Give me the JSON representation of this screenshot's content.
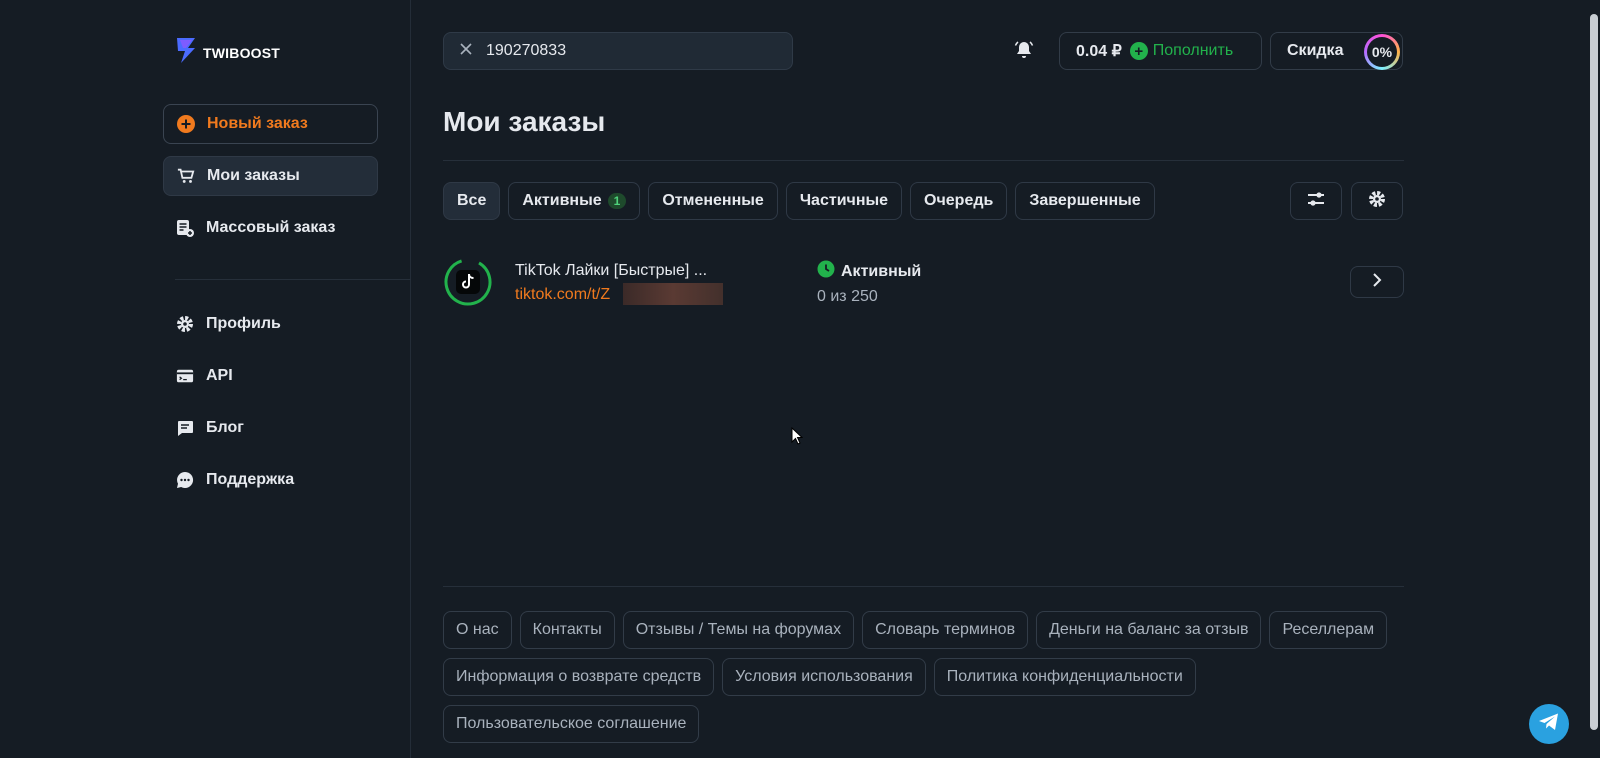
{
  "brand": {
    "name": "TWIBOOST"
  },
  "sidebar": {
    "new_order": "Новый заказ",
    "my_orders": "Мои заказы",
    "mass_order": "Массовый заказ",
    "profile": "Профиль",
    "api": "API",
    "blog": "Блог",
    "support": "Поддержка"
  },
  "header": {
    "search_value": "190270833",
    "balance": "0.04 ₽",
    "topup_label": "Пополнить",
    "discount_label": "Скидка",
    "discount_value": "0%"
  },
  "main": {
    "title": "Мои заказы",
    "tabs": [
      {
        "label": "Все"
      },
      {
        "label": "Активные",
        "count": "1"
      },
      {
        "label": "Отмененные"
      },
      {
        "label": "Частичные"
      },
      {
        "label": "Очередь"
      },
      {
        "label": "Завершенные"
      }
    ],
    "orders": [
      {
        "name": "TikTok Лайки [Быстрые] ...",
        "link": "tiktok.com/t/Z",
        "status": "Активный",
        "progress": "0 из 250"
      }
    ]
  },
  "footer": {
    "links": [
      "О нас",
      "Контакты",
      "Отзывы / Темы на форумах",
      "Словарь терминов",
      "Деньги на баланс за отзыв",
      "Реселлерам",
      "Информация о возврате средств",
      "Условия использования",
      "Политика конфиденциальности",
      "Пользовательское соглашение"
    ]
  },
  "colors": {
    "background": "#151c24",
    "accent_orange": "#f07a1e",
    "success_green": "#22b24c",
    "telegram_blue": "#2aa1e0"
  },
  "icons": {
    "logo": "lightning-logo-icon",
    "new_order": "plus-circle-icon",
    "my_orders": "cart-icon",
    "mass_order": "list-plus-icon",
    "profile": "gear-icon",
    "api": "api-card-icon",
    "blog": "chat-bubble-icon",
    "support": "chat-dots-icon",
    "search_clear": "close-icon",
    "notifications": "bell-icon",
    "filter": "sliders-icon",
    "settings": "gear-icon",
    "order_platform": "tiktok-icon",
    "status": "clock-icon",
    "open_order": "chevron-right-icon",
    "telegram": "telegram-icon"
  }
}
